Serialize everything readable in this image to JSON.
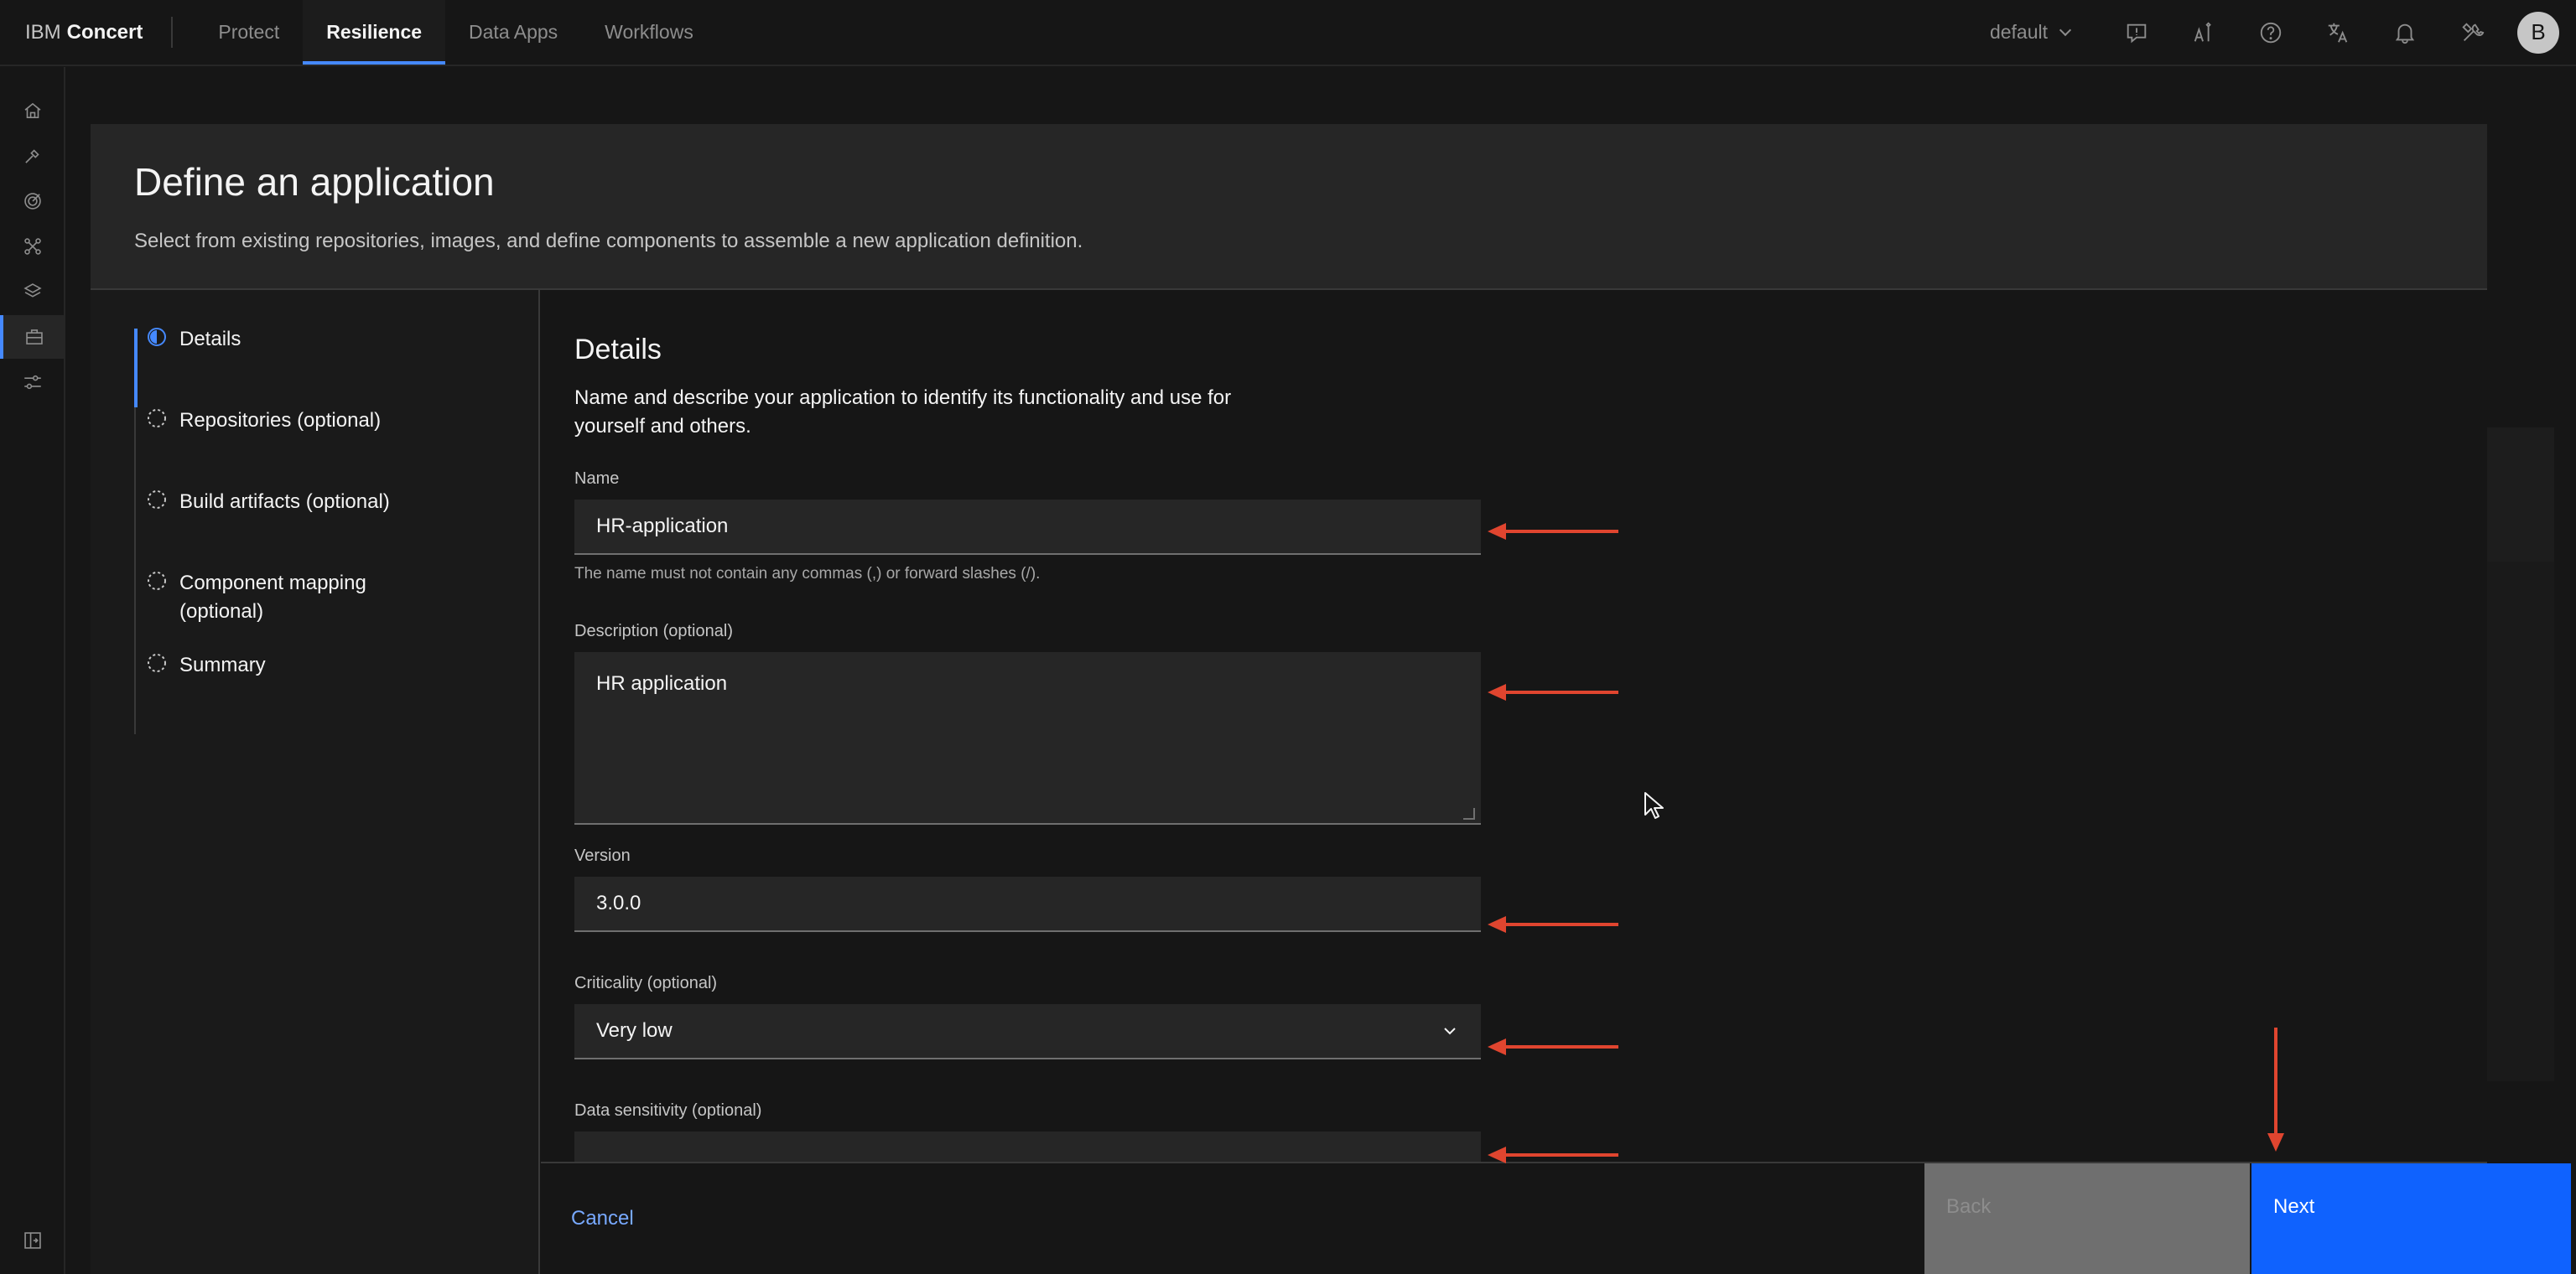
{
  "header": {
    "brand_prefix": "IBM",
    "brand_name": "Concert",
    "nav": [
      "Protect",
      "Resilience",
      "Data Apps",
      "Workflows"
    ],
    "active_nav": "Resilience",
    "tenant": "default",
    "avatar_initial": "B",
    "icons": [
      "feedback-icon",
      "ai-icon",
      "help-icon",
      "translate-icon",
      "notification-icon",
      "tools-icon"
    ]
  },
  "rail": {
    "icons": [
      "home-icon",
      "build-tool-icon",
      "target-icon",
      "graph-icon",
      "layers-icon",
      "application-icon",
      "settings-adjust-icon",
      "side-panel-icon"
    ]
  },
  "modal": {
    "title": "Define an application",
    "subtitle": "Select from existing repositories, images, and define components to assemble a new application definition."
  },
  "steps": [
    {
      "label": "Details",
      "state": "current"
    },
    {
      "label": "Repositories (optional)",
      "state": "incomplete"
    },
    {
      "label": "Build artifacts (optional)",
      "state": "incomplete"
    },
    {
      "label": "Component mapping (optional)",
      "state": "incomplete"
    },
    {
      "label": "Summary",
      "state": "incomplete"
    }
  ],
  "form": {
    "title": "Details",
    "description": "Name and describe your application to identify its functionality and use for yourself and others.",
    "name_label": "Name",
    "name_value": "HR-application",
    "name_helper": "The name must not contain any commas (,) or forward slashes (/).",
    "description_label": "Description (optional)",
    "description_value": "HR application",
    "version_label": "Version",
    "version_value": "3.0.0",
    "criticality_label": "Criticality (optional)",
    "criticality_value": "Very low",
    "sensitivity_label": "Data sensitivity (optional)"
  },
  "footer": {
    "cancel": "Cancel",
    "back": "Back",
    "next": "Next"
  },
  "colors": {
    "accent": "#0f62fe",
    "annotation": "#e0452f",
    "link": "#78a9ff"
  }
}
